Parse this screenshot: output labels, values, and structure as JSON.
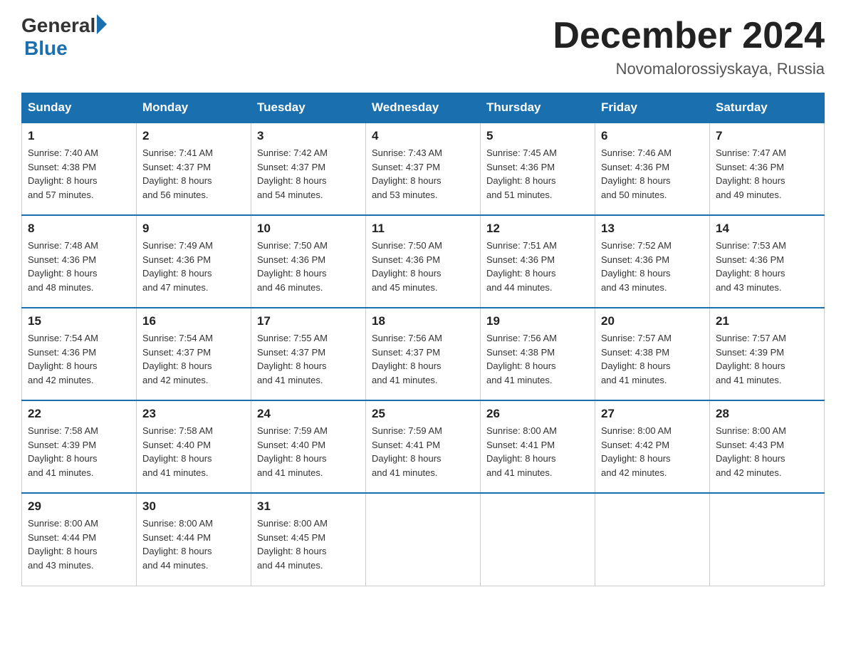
{
  "header": {
    "logo_general": "General",
    "logo_blue": "Blue",
    "month_year": "December 2024",
    "location": "Novomalorossiyskaya, Russia"
  },
  "days_of_week": [
    "Sunday",
    "Monday",
    "Tuesday",
    "Wednesday",
    "Thursday",
    "Friday",
    "Saturday"
  ],
  "weeks": [
    [
      {
        "day": "1",
        "sunrise": "7:40 AM",
        "sunset": "4:38 PM",
        "daylight": "8 hours and 57 minutes."
      },
      {
        "day": "2",
        "sunrise": "7:41 AM",
        "sunset": "4:37 PM",
        "daylight": "8 hours and 56 minutes."
      },
      {
        "day": "3",
        "sunrise": "7:42 AM",
        "sunset": "4:37 PM",
        "daylight": "8 hours and 54 minutes."
      },
      {
        "day": "4",
        "sunrise": "7:43 AM",
        "sunset": "4:37 PM",
        "daylight": "8 hours and 53 minutes."
      },
      {
        "day": "5",
        "sunrise": "7:45 AM",
        "sunset": "4:36 PM",
        "daylight": "8 hours and 51 minutes."
      },
      {
        "day": "6",
        "sunrise": "7:46 AM",
        "sunset": "4:36 PM",
        "daylight": "8 hours and 50 minutes."
      },
      {
        "day": "7",
        "sunrise": "7:47 AM",
        "sunset": "4:36 PM",
        "daylight": "8 hours and 49 minutes."
      }
    ],
    [
      {
        "day": "8",
        "sunrise": "7:48 AM",
        "sunset": "4:36 PM",
        "daylight": "8 hours and 48 minutes."
      },
      {
        "day": "9",
        "sunrise": "7:49 AM",
        "sunset": "4:36 PM",
        "daylight": "8 hours and 47 minutes."
      },
      {
        "day": "10",
        "sunrise": "7:50 AM",
        "sunset": "4:36 PM",
        "daylight": "8 hours and 46 minutes."
      },
      {
        "day": "11",
        "sunrise": "7:50 AM",
        "sunset": "4:36 PM",
        "daylight": "8 hours and 45 minutes."
      },
      {
        "day": "12",
        "sunrise": "7:51 AM",
        "sunset": "4:36 PM",
        "daylight": "8 hours and 44 minutes."
      },
      {
        "day": "13",
        "sunrise": "7:52 AM",
        "sunset": "4:36 PM",
        "daylight": "8 hours and 43 minutes."
      },
      {
        "day": "14",
        "sunrise": "7:53 AM",
        "sunset": "4:36 PM",
        "daylight": "8 hours and 43 minutes."
      }
    ],
    [
      {
        "day": "15",
        "sunrise": "7:54 AM",
        "sunset": "4:36 PM",
        "daylight": "8 hours and 42 minutes."
      },
      {
        "day": "16",
        "sunrise": "7:54 AM",
        "sunset": "4:37 PM",
        "daylight": "8 hours and 42 minutes."
      },
      {
        "day": "17",
        "sunrise": "7:55 AM",
        "sunset": "4:37 PM",
        "daylight": "8 hours and 41 minutes."
      },
      {
        "day": "18",
        "sunrise": "7:56 AM",
        "sunset": "4:37 PM",
        "daylight": "8 hours and 41 minutes."
      },
      {
        "day": "19",
        "sunrise": "7:56 AM",
        "sunset": "4:38 PM",
        "daylight": "8 hours and 41 minutes."
      },
      {
        "day": "20",
        "sunrise": "7:57 AM",
        "sunset": "4:38 PM",
        "daylight": "8 hours and 41 minutes."
      },
      {
        "day": "21",
        "sunrise": "7:57 AM",
        "sunset": "4:39 PM",
        "daylight": "8 hours and 41 minutes."
      }
    ],
    [
      {
        "day": "22",
        "sunrise": "7:58 AM",
        "sunset": "4:39 PM",
        "daylight": "8 hours and 41 minutes."
      },
      {
        "day": "23",
        "sunrise": "7:58 AM",
        "sunset": "4:40 PM",
        "daylight": "8 hours and 41 minutes."
      },
      {
        "day": "24",
        "sunrise": "7:59 AM",
        "sunset": "4:40 PM",
        "daylight": "8 hours and 41 minutes."
      },
      {
        "day": "25",
        "sunrise": "7:59 AM",
        "sunset": "4:41 PM",
        "daylight": "8 hours and 41 minutes."
      },
      {
        "day": "26",
        "sunrise": "8:00 AM",
        "sunset": "4:41 PM",
        "daylight": "8 hours and 41 minutes."
      },
      {
        "day": "27",
        "sunrise": "8:00 AM",
        "sunset": "4:42 PM",
        "daylight": "8 hours and 42 minutes."
      },
      {
        "day": "28",
        "sunrise": "8:00 AM",
        "sunset": "4:43 PM",
        "daylight": "8 hours and 42 minutes."
      }
    ],
    [
      {
        "day": "29",
        "sunrise": "8:00 AM",
        "sunset": "4:44 PM",
        "daylight": "8 hours and 43 minutes."
      },
      {
        "day": "30",
        "sunrise": "8:00 AM",
        "sunset": "4:44 PM",
        "daylight": "8 hours and 44 minutes."
      },
      {
        "day": "31",
        "sunrise": "8:00 AM",
        "sunset": "4:45 PM",
        "daylight": "8 hours and 44 minutes."
      },
      null,
      null,
      null,
      null
    ]
  ],
  "labels": {
    "sunrise": "Sunrise:",
    "sunset": "Sunset:",
    "daylight": "Daylight:"
  }
}
